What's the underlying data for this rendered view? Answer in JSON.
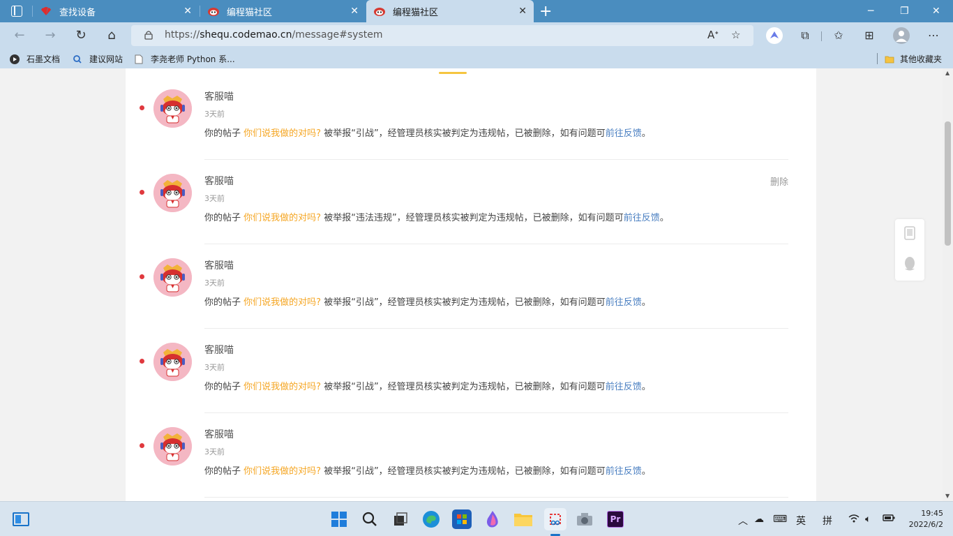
{
  "browser": {
    "tabs": [
      {
        "label": "查找设备",
        "icon": "huawei-logo-icon"
      },
      {
        "label": "编程猫社区",
        "icon": "codemao-logo-icon"
      },
      {
        "label": "编程猫社区",
        "icon": "codemao-logo-icon"
      }
    ],
    "active_tab": 2,
    "new_tab": "+",
    "url_prefix": "https://",
    "url_host": "shequ.codemao.cn",
    "url_path": "/message#system",
    "bookmarks": [
      {
        "label": "石墨文档",
        "icon": "shimo-icon"
      },
      {
        "label": "建议网站",
        "icon": "search-icon"
      },
      {
        "label": "李尧老师 Python 系...",
        "icon": "page-icon"
      }
    ],
    "other_bookmarks": "其他收藏夹"
  },
  "messages": [
    {
      "sender": "客服喵",
      "time": "3天前",
      "prefix": "你的帖子",
      "post": "你们说我做的对吗?",
      "reason": "被举报“引战”，经管理员核实被判定为违规帖，已被删除，如有问题可",
      "link": "前往反馈",
      "end": "。",
      "delete": ""
    },
    {
      "sender": "客服喵",
      "time": "3天前",
      "prefix": "你的帖子",
      "post": "你们说我做的对吗?",
      "reason": "被举报“违法违规”，经管理员核实被判定为违规帖，已被删除，如有问题可",
      "link": "前往反馈",
      "end": "。",
      "delete": "删除"
    },
    {
      "sender": "客服喵",
      "time": "3天前",
      "prefix": "你的帖子",
      "post": "你们说我做的对吗?",
      "reason": "被举报“引战”，经管理员核实被判定为违规帖，已被删除，如有问题可",
      "link": "前往反馈",
      "end": "。",
      "delete": ""
    },
    {
      "sender": "客服喵",
      "time": "3天前",
      "prefix": "你的帖子",
      "post": "你们说我做的对吗?",
      "reason": "被举报“引战”，经管理员核实被判定为违规帖，已被删除，如有问题可",
      "link": "前往反馈",
      "end": "。",
      "delete": ""
    },
    {
      "sender": "客服喵",
      "time": "3天前",
      "prefix": "你的帖子",
      "post": "你们说我做的对吗?",
      "reason": "被举报“引战”，经管理员核实被判定为违规帖，已被删除，如有问题可",
      "link": "前往反馈",
      "end": "。",
      "delete": ""
    }
  ],
  "taskbar": {
    "ime_lang": "英",
    "ime_mode": "拼",
    "time": "19:45",
    "date": "2022/6/2",
    "pr_label": "Pr"
  },
  "colors": {
    "unread_dot": "#e0393e",
    "post_link": "#f5a623",
    "feedback_link": "#4a7fc1",
    "tab_underline": "#f5c540"
  }
}
